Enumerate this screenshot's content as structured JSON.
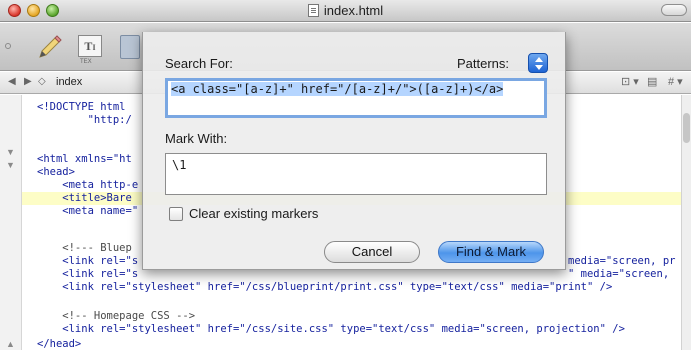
{
  "window": {
    "title": "index.html"
  },
  "toolbar": {
    "icons": [
      "pencil-icon",
      "text-icon",
      "tex-icon"
    ],
    "tex_label": "TEX"
  },
  "navbar": {
    "file_name": "index"
  },
  "editor": {
    "lines": [
      "<!DOCTYPE html",
      "        \"http:/",
      "",
      "<html xmlns=\"ht",
      "<head>",
      "    <meta http-e",
      "    <title>Bare",
      "    <meta name=\"",
      "",
      "    <!--- Bluep",
      "    <link rel=\"s",
      "    <link rel=\"s",
      "    <link rel=\"stylesheet\" href=\"/css/blueprint/print.css\" type=\"text/css\" media=\"print\" />",
      "",
      "    <!-- Homepage CSS -->",
      "    <link rel=\"stylesheet\" href=\"/css/site.css\" type=\"text/css\" media=\"screen, projection\" />",
      "</head>"
    ],
    "right_fragments": [
      "media=\"screen, pr",
      "\" media=\"screen,"
    ]
  },
  "dialog": {
    "search_label": "Search For:",
    "patterns_label": "Patterns:",
    "search_value": "<a class=\"[a-z]+\" href=\"/[a-z]+/\">([a-z]+)</a>",
    "mark_label": "Mark With:",
    "mark_value": "\\1",
    "clear_label": "Clear existing markers",
    "cancel_label": "Cancel",
    "find_label": "Find & Mark"
  },
  "colors": {
    "accent": "#4d95ea",
    "code_tag": "#16229e",
    "highlight_line": "#fdfdc6"
  }
}
